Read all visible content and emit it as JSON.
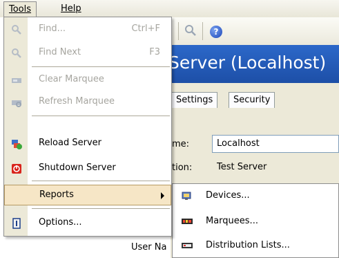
{
  "menubar": {
    "tools": "Tools",
    "help": "Help"
  },
  "window": {
    "title": "Server (Localhost)",
    "tabs": [
      "Settings",
      "Security"
    ],
    "fields": [
      {
        "label": "me:",
        "value": "Localhost"
      },
      {
        "label": "tion:",
        "value": "Test Server"
      },
      {
        "label": "User Na",
        "value": ""
      }
    ]
  },
  "tools_menu": {
    "items": [
      {
        "label": "Find...",
        "shortcut": "Ctrl+F",
        "icon": "find-icon",
        "enabled": false
      },
      {
        "label": "Find Next",
        "shortcut": "F3",
        "icon": "find-next-icon",
        "enabled": false
      },
      {
        "label": "Clear Marquee",
        "shortcut": "",
        "icon": "clear-marquee-icon",
        "enabled": false
      },
      {
        "label": "Refresh Marquee",
        "shortcut": "",
        "icon": "refresh-marquee-icon",
        "enabled": false
      },
      {
        "label": "Reload Server",
        "shortcut": "",
        "icon": "reload-server-icon",
        "enabled": true
      },
      {
        "label": "Shutdown Server",
        "shortcut": "",
        "icon": "shutdown-server-icon",
        "enabled": true
      },
      {
        "label": "Reports",
        "shortcut": "",
        "icon": "",
        "enabled": true,
        "submenu": true
      },
      {
        "label": "Options...",
        "shortcut": "",
        "icon": "options-icon",
        "enabled": true
      }
    ]
  },
  "reports_submenu": {
    "items": [
      {
        "label": "Devices...",
        "icon": "devices-icon"
      },
      {
        "label": "Marquees...",
        "icon": "marquees-icon"
      },
      {
        "label": "Distribution Lists...",
        "icon": "distribution-lists-icon"
      }
    ]
  },
  "colors": {
    "title_bar": "#1d4fa7",
    "highlight": "#f6e6c6",
    "menu_gutter": "#ece9d8"
  }
}
